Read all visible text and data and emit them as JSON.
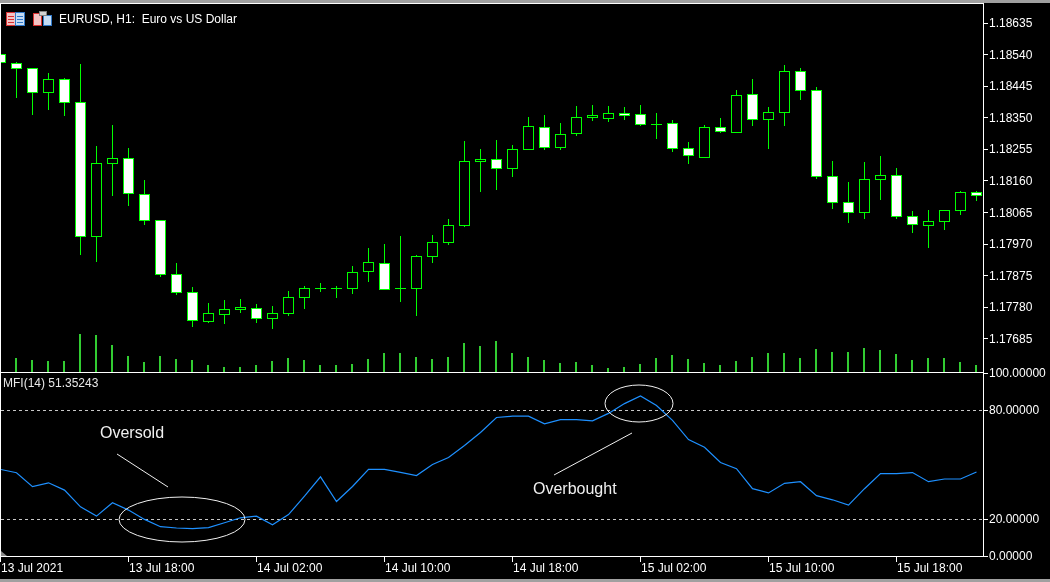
{
  "chart_window": {
    "title": "EURUSD, H1:  Euro vs US Dollar"
  },
  "price_panel": {
    "price_axis": [
      "1.18635",
      "1.18540",
      "1.18445",
      "1.18350",
      "1.18255",
      "1.18160",
      "1.18065",
      "1.17970",
      "1.17875",
      "1.17780",
      "1.17685"
    ]
  },
  "indicator_panel": {
    "chart_data": {
      "type": "line",
      "title": "MFI(14) 51.35243",
      "categories": [
        null,
        null,
        null,
        null,
        null,
        null,
        null,
        null,
        null,
        null,
        null,
        null,
        null,
        null,
        null,
        null,
        null,
        null,
        null,
        null,
        null,
        null,
        null,
        null,
        null,
        null,
        null,
        null,
        null,
        null,
        null,
        null,
        null,
        null,
        null,
        null,
        null,
        null,
        null,
        null,
        null,
        null,
        null,
        null,
        null,
        null,
        null,
        null,
        null,
        null,
        null,
        null,
        null,
        null,
        null,
        null,
        null,
        null,
        null,
        null,
        null,
        null
      ],
      "ylim": [
        0,
        100
      ],
      "yticks": [
        {
          "value": 100,
          "label": "100.00000"
        },
        {
          "value": 80,
          "label": "80.00000"
        },
        {
          "value": 20,
          "label": "20.00000"
        },
        {
          "value": 0,
          "label": "0.00000"
        }
      ],
      "series": [
        {
          "color": "#1e90ff",
          "values": [
            47.3,
            45.5,
            37.9,
            40.0,
            36.0,
            26.9,
            21.8,
            29.1,
            25.1,
            20.0,
            16.0,
            15.3,
            14.9,
            15.5,
            18.2,
            20.9,
            21.8,
            17.1,
            22.6,
            32.7,
            43.3,
            29.8,
            38.0,
            47.3,
            47.3,
            45.7,
            44.0,
            50.0,
            53.8,
            60.4,
            67.5,
            75.7,
            76.4,
            76.4,
            72.2,
            74.5,
            74.5,
            73.9,
            77.9,
            83.3,
            87.5,
            82.2,
            74.1,
            63.6,
            59.4,
            51.1,
            47.7,
            36.8,
            34.5,
            39.7,
            40.6,
            33.0,
            30.7,
            27.8,
            36.8,
            45.0,
            45.0,
            45.6,
            40.6,
            42.1,
            42.1,
            45.9
          ]
        }
      ],
      "annotations": [
        {
          "text": "Oversold"
        },
        {
          "text": "Overbought"
        }
      ]
    }
  },
  "time_axis": [
    "13 Jul 2021",
    "13 Jul 18:00",
    "14 Jul 02:00",
    "14 Jul 10:00",
    "14 Jul 18:00",
    "15 Jul 02:00",
    "15 Jul 10:00",
    "15 Jul 18:00"
  ]
}
